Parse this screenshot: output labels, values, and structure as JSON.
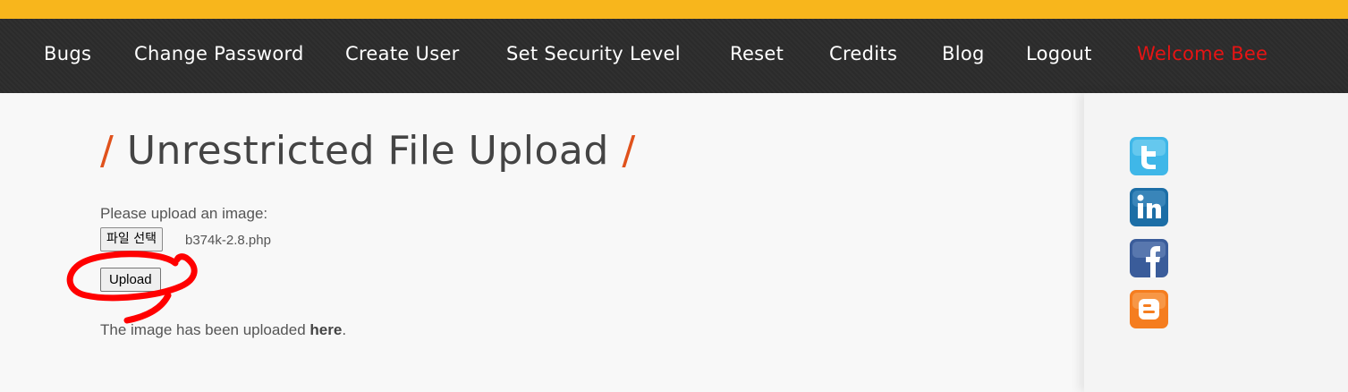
{
  "nav": {
    "items": [
      {
        "label": "Bugs"
      },
      {
        "label": "Change Password"
      },
      {
        "label": "Create User"
      },
      {
        "label": "Set Security Level"
      },
      {
        "label": "Reset"
      },
      {
        "label": "Credits"
      },
      {
        "label": "Blog"
      },
      {
        "label": "Logout"
      },
      {
        "label": "Welcome Bee"
      }
    ]
  },
  "page": {
    "title": "Unrestricted File Upload",
    "slash": "/"
  },
  "form": {
    "prompt": "Please upload an image:",
    "file_button_label": "파일 선택",
    "file_name": "b374k-2.8.php",
    "upload_label": "Upload"
  },
  "result": {
    "text": "The image has been uploaded",
    "link_text": "here",
    "period": "."
  },
  "social": [
    "twitter-icon",
    "linkedin-icon",
    "facebook-icon",
    "blogger-icon"
  ],
  "colors": {
    "top_accent": "#f8b61c",
    "nav_background": "#2c2c2c",
    "welcome": "#e61414",
    "title_slash": "#e0521c",
    "annotation": "#ff0000"
  }
}
